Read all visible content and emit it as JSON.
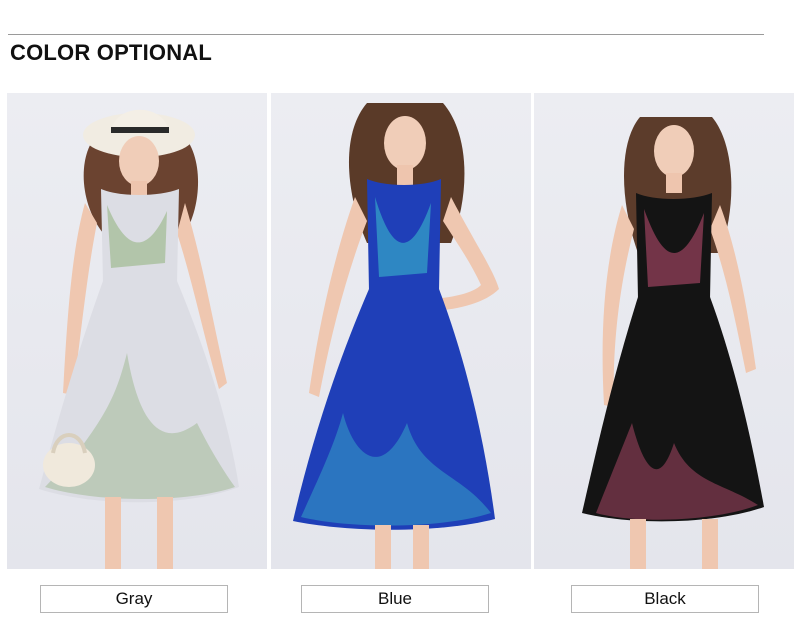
{
  "header": {
    "title": "COLOR OPTIONAL"
  },
  "variants": [
    {
      "label": "Gray",
      "dress_color": "#dcdde4",
      "accent_color": "#8fb07a"
    },
    {
      "label": "Blue",
      "dress_color": "#1f3fb8",
      "accent_color": "#39b7c9"
    },
    {
      "label": "Black",
      "dress_color": "#141414",
      "accent_color": "#b24a6a"
    }
  ],
  "colors": {
    "background": "#ffffff",
    "rule": "#9a9a9a",
    "label_border": "#b5b5b5",
    "text": "#111111"
  }
}
